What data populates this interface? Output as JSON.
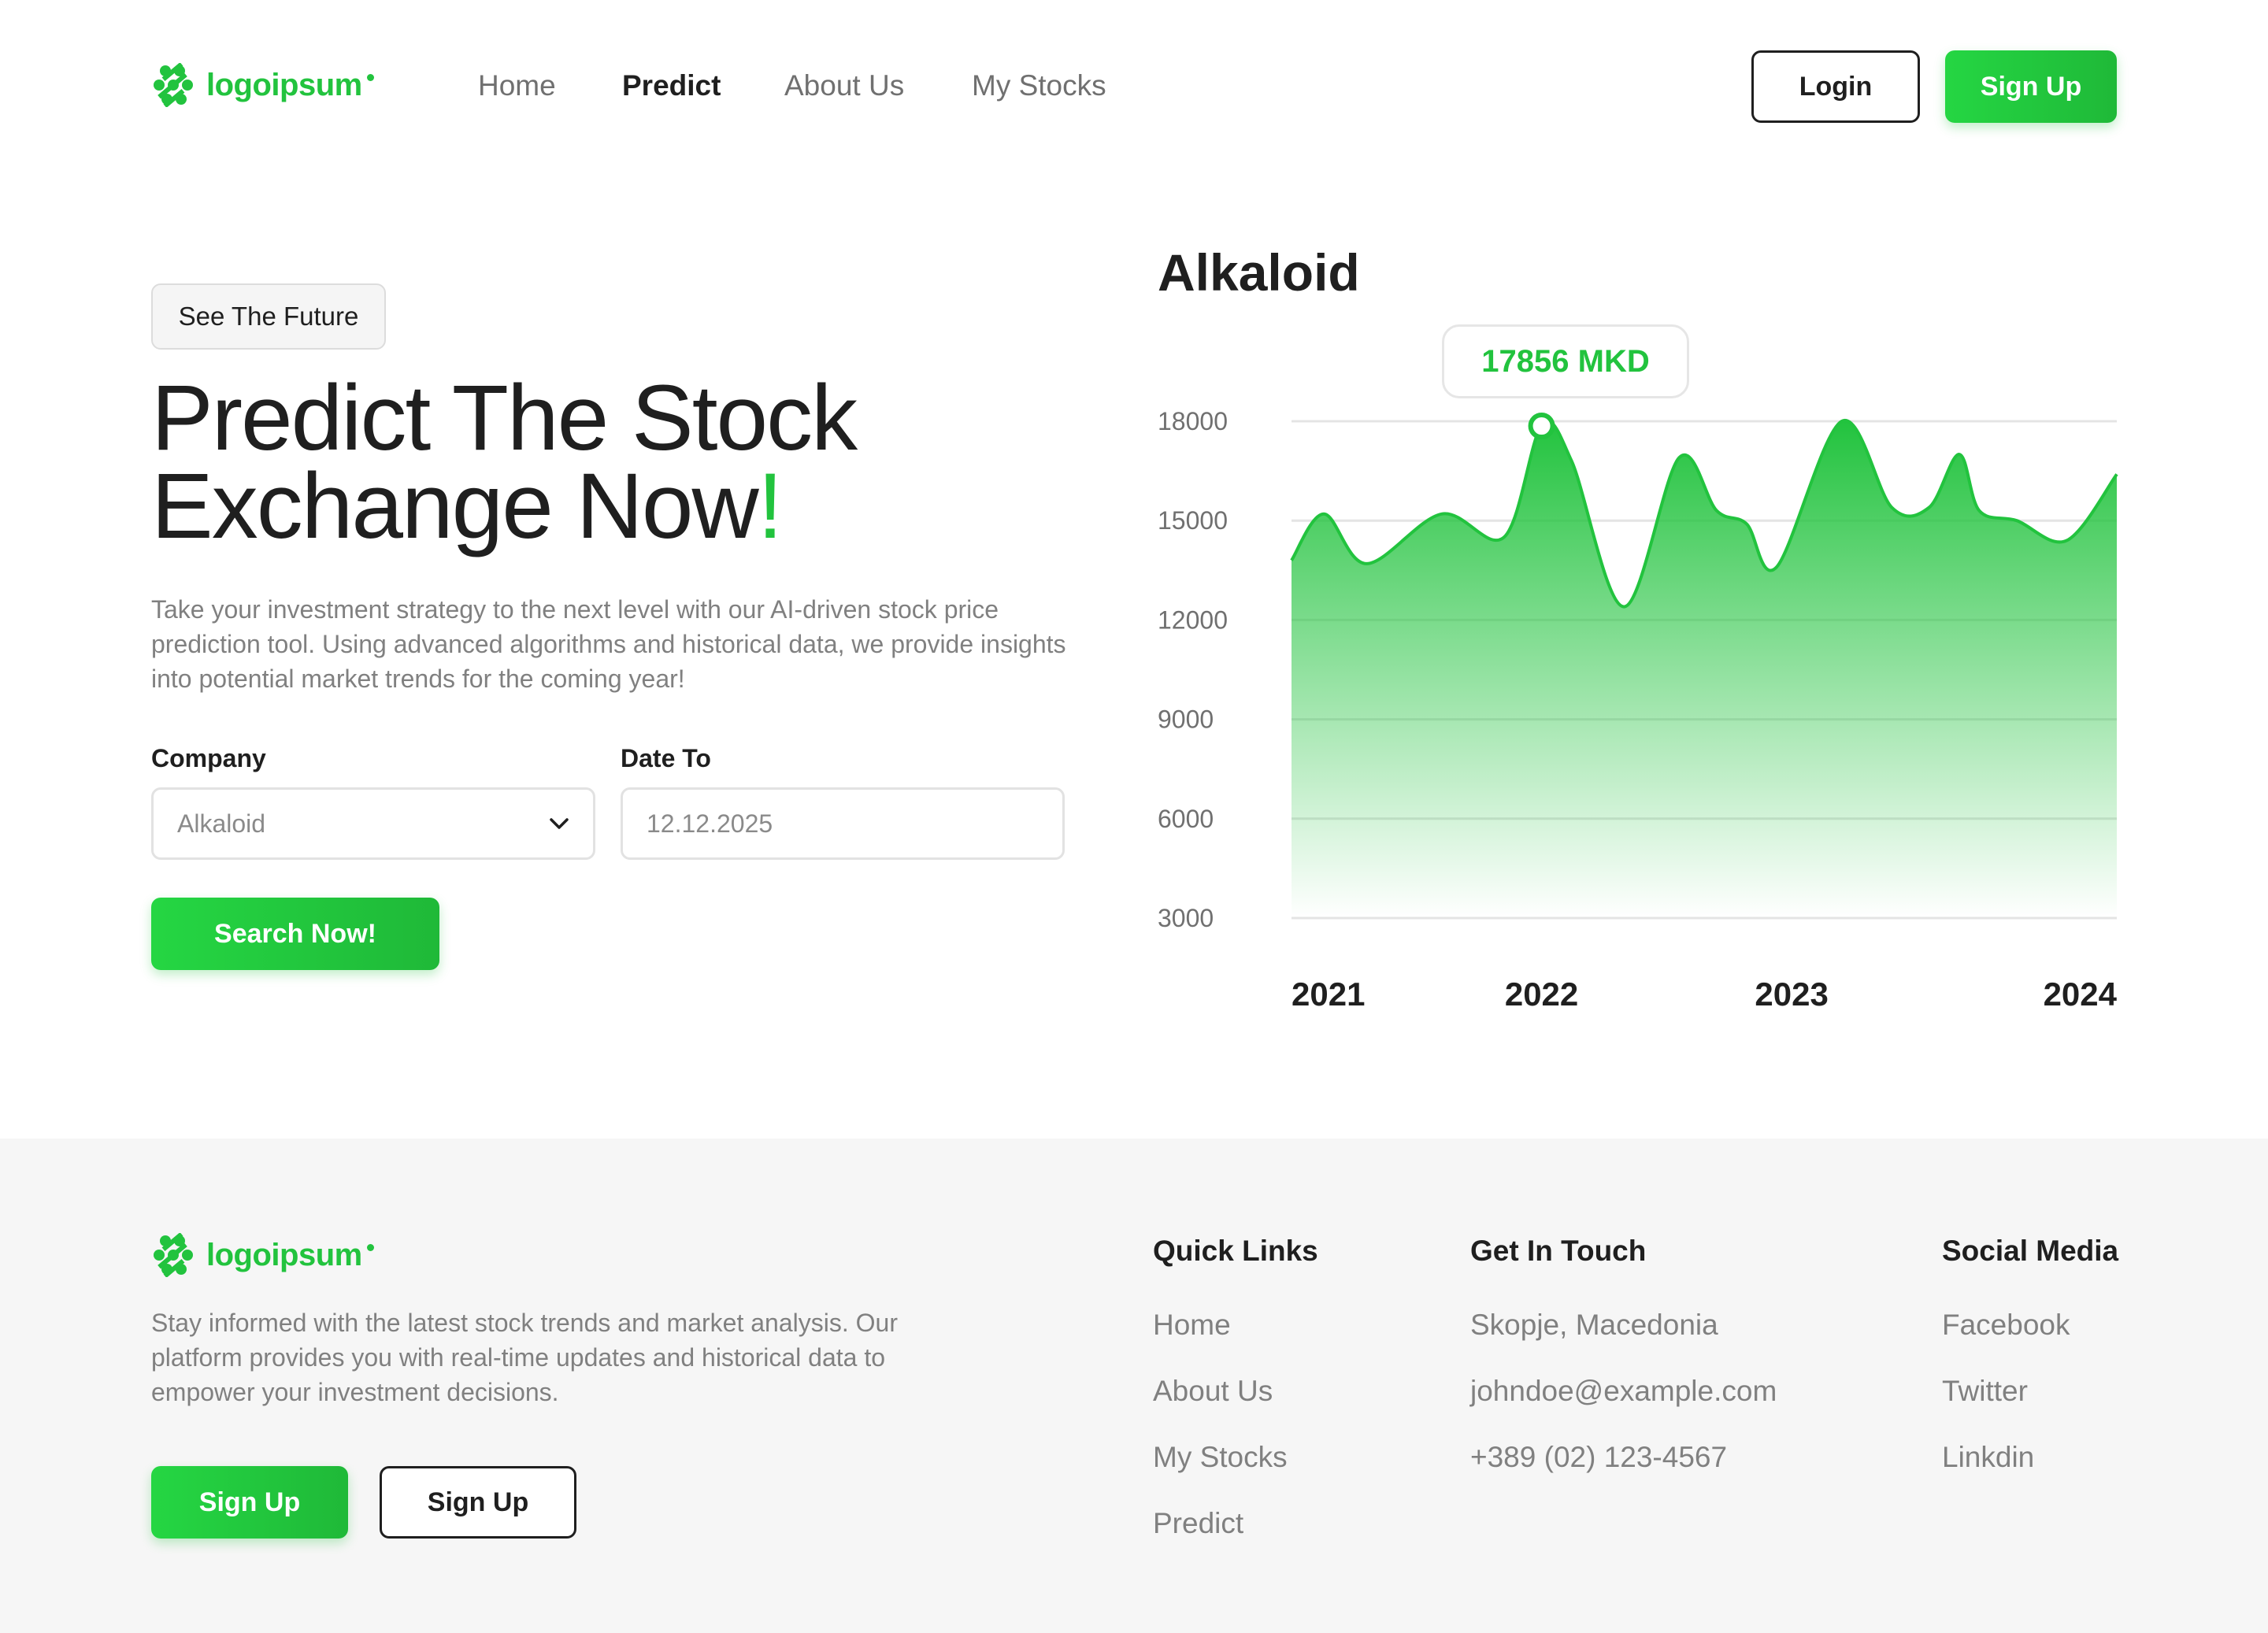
{
  "brand": {
    "name": "logoipsum",
    "color": "#22c33e",
    "icon": "logo-mark-icon"
  },
  "nav": {
    "items": [
      {
        "label": "Home",
        "active": false
      },
      {
        "label": "Predict",
        "active": true
      },
      {
        "label": "About Us",
        "active": false
      },
      {
        "label": "My Stocks",
        "active": false
      }
    ],
    "login_label": "Login",
    "signup_label": "Sign Up"
  },
  "hero": {
    "badge": "See The Future",
    "title_line1": "Predict The Stock",
    "title_line2": "Exchange Now",
    "title_accent": "!",
    "description": "Take your investment strategy to the next level with our AI-driven stock price prediction tool. Using advanced algorithms and historical data, we provide insights into potential market trends for the coming year!",
    "company_label": "Company",
    "company_value": "Alkaloid",
    "date_label": "Date To",
    "date_value": "12.12.2025",
    "search_label": "Search Now!"
  },
  "chart": {
    "title": "Alkaloid",
    "tooltip": "17856 MKD",
    "dropdown_icon": "chevron-down-icon"
  },
  "chart_data": {
    "type": "area",
    "title": "Alkaloid",
    "xlabel": "",
    "ylabel": "",
    "x_ticks": [
      "2021",
      "2022",
      "2023",
      "2024"
    ],
    "y_ticks": [
      18000,
      15000,
      12000,
      9000,
      6000,
      3000
    ],
    "ylim": [
      3000,
      18000
    ],
    "xlim": [
      2021,
      2024.3
    ],
    "grid": true,
    "series": [
      {
        "color": "#22c33e",
        "x": [
          2021.0,
          2021.13,
          2021.3,
          2021.6,
          2021.85,
          2022.0,
          2022.12,
          2022.33,
          2022.55,
          2022.7,
          2022.82,
          2022.94,
          2023.2,
          2023.4,
          2023.55,
          2023.67,
          2023.75,
          2023.9,
          2024.1,
          2024.3
        ],
        "values": [
          13800,
          15200,
          13700,
          15200,
          14500,
          17856,
          16800,
          12400,
          16900,
          15300,
          14900,
          13600,
          18000,
          15400,
          15400,
          17000,
          15300,
          15000,
          14400,
          16400
        ]
      }
    ],
    "highlight": {
      "x": 2022.0,
      "value": 17856,
      "label": "17856 MKD"
    }
  },
  "footer": {
    "description": "Stay informed with the latest stock trends and market analysis. Our platform provides you with real-time updates and historical data to empower your investment decisions.",
    "primary_button": "Sign Up",
    "secondary_button": "Sign Up",
    "quick_links": {
      "heading": "Quick Links",
      "items": [
        "Home",
        "About Us",
        "My Stocks",
        "Predict"
      ]
    },
    "contact": {
      "heading": "Get In Touch",
      "items": [
        "Skopje, Macedonia",
        "johndoe@example.com",
        "+389 (02) 123-4567"
      ]
    },
    "social": {
      "heading": "Social Media",
      "items": [
        "Facebook",
        "Twitter",
        "Linkdin"
      ]
    }
  }
}
